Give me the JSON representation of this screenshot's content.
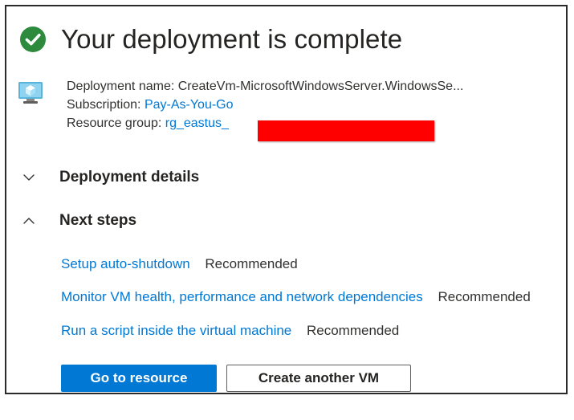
{
  "header": {
    "title": "Your deployment is complete"
  },
  "deployment": {
    "name_label": "Deployment name:",
    "name_value": "CreateVm-MicrosoftWindowsServer.WindowsSe...",
    "subscription_label": "Subscription:",
    "subscription_value": "Pay-As-You-Go",
    "resource_group_label": "Resource group:",
    "resource_group_value": "rg_eastus_"
  },
  "sections": {
    "details": "Deployment details",
    "next_steps": "Next steps"
  },
  "next_steps": [
    {
      "link": "Setup auto-shutdown",
      "badge": "Recommended"
    },
    {
      "link": "Monitor VM health, performance and network dependencies",
      "badge": "Recommended"
    },
    {
      "link": "Run a script inside the virtual machine",
      "badge": "Recommended"
    }
  ],
  "buttons": {
    "go_to_resource": "Go to resource",
    "create_another": "Create another VM"
  },
  "colors": {
    "accent": "#0078d4",
    "success": "#2e8b3e",
    "redaction": "#ff0000"
  },
  "icons": {
    "status": "check-circle-icon",
    "resource": "virtual-machine-icon",
    "collapsed": "chevron-down-icon",
    "expanded": "chevron-up-icon"
  }
}
